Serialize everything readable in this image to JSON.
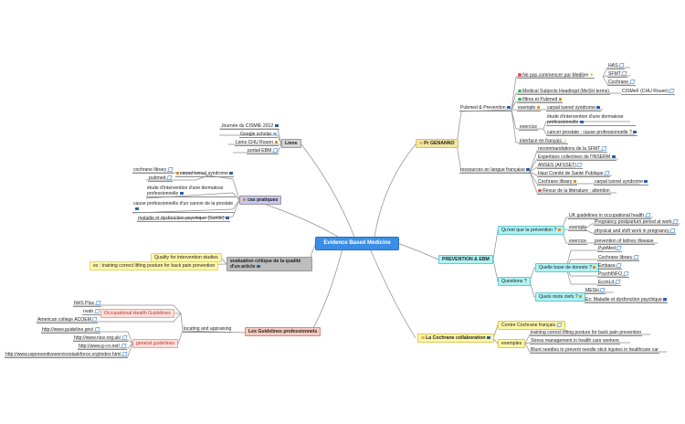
{
  "central": "Evidence Based Medicine",
  "liens": {
    "title": "Liens",
    "items": [
      "Journée du CISMIE 2012",
      "Google scholar",
      "Liens CHU Rouen",
      "portail EBM"
    ]
  },
  "cas": {
    "title": "cas pratiques",
    "cochrane": "cochrane library",
    "pubmed": "pubmed",
    "carpal": "carpal tunnel syndrome",
    "dermatose": "étude d'intervention d'une dermatose professionnelle",
    "cancer": "cause professionnelle d'un cancer de la prostate",
    "maladie": "maladie et dysfonction psychique (Suède)"
  },
  "evaluation": {
    "title": "evaluation critique de la qualité d'un article",
    "quality": "Quality for intervention studies",
    "training": "ex : training correct lifting posture for back pain prevention"
  },
  "guidelines": {
    "title": "Les Guidelines professionnels",
    "locating": "locating and appraising",
    "ohg": "Occupational Health Guidelines",
    "nhs": "NHS Plus",
    "nvab": "nvab",
    "acoem": "American college ACOEM",
    "general": "general guidelines",
    "links": [
      "http://www.guideline.gov/",
      "http://www.nice.org.uk/",
      "http://www.g-i-n.net/",
      "http://www.uspreventiveservicestaskforce.org/index.html"
    ]
  },
  "genanno": {
    "title": "Pr GENANNO",
    "pubmed_prevention": "Pubmed & Prevention",
    "medline": "Ne pas commencer par Medline",
    "has": "HAS",
    "sfmt": "SFMT",
    "cochrane": "Cochrane",
    "mesh": "Medical Subjects Headingd (MeSH terms)",
    "cismef": "CISMeF (CHU Rouen)",
    "filtres": "filtres et Pubmed",
    "exemple": "exemple",
    "carpal": "carpal tunnel syndrome",
    "exercice": "exercice",
    "dermatose": "étude d'intervention d'une dermatose professionnelle",
    "cancer": "cancer prostate : cause professionnelle ?",
    "interface": "interface en français",
    "ressources": "ressources en langue française",
    "res_items": [
      "recommandations de la SFMT",
      "Expertises collectives de l'INSERM",
      "ANSES (AFSSET)",
      "Haut Comité de Santé Publique",
      "Cochrane library",
      "Revue de la littérature : attention"
    ],
    "res_carpal": "carpal tunnel syndrome"
  },
  "prevention": {
    "title": "PREVENTION & EBM",
    "q1": "Qu'est que la prévention ?",
    "uk": "UK guidelines in occupational health",
    "exemple": "exemple",
    "preg1": "Pregnancy postpartum period at work",
    "preg2": "physical and shift work in pregnancy",
    "exercice": "exercice",
    "kidney": "prevention of kidney disease",
    "questions": "Questions ?",
    "base": "Quelle base de donnée ?",
    "bases": [
      "PubMed",
      "Cochrane library",
      "Embase",
      "PsychINFO",
      "EconLit"
    ],
    "mots": "Quels mots clefs ?",
    "mesh": "MESH",
    "maladie": "Ex: Maladie et dysfonction psychique"
  },
  "cochrane": {
    "title": "La Cochrane collaboration",
    "centre": "Centre Cochrane français",
    "exemples": "exemples",
    "items": [
      "training correct lifting posture for back pain prevention",
      "Stress management in health care workers",
      "Blunt needles to prevent needle stick injuries in healthcare car"
    ]
  },
  "colors": {
    "central": "#3b8ee6",
    "liens": "#d6d6d6",
    "cas": "#c9c7f2",
    "evaluation": "#bdbdbd",
    "yellow": "#fff7a8",
    "guidelines": "#f6c9c0",
    "pink": "#fbe0dc",
    "cyan": "#aef3f5",
    "gold": "#f3e6a2",
    "orange": "#e8b55a"
  }
}
